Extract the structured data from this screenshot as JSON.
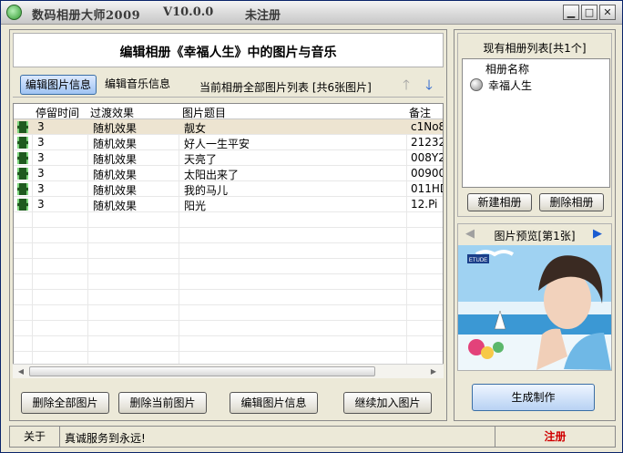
{
  "window": {
    "title": "数码相册大师2009",
    "version": "V10.0.0",
    "reg_state": "未注册",
    "min_glyph": "▁",
    "max_glyph": "□",
    "close_glyph": "✕"
  },
  "editor": {
    "heading": "编辑相册《幸福人生》中的图片与音乐",
    "tabs": [
      {
        "label": "编辑图片信息",
        "active": true
      },
      {
        "label": "编辑音乐信息",
        "active": false
      }
    ],
    "list_caption": "当前相册全部图片列表 [共6张图片]",
    "up_glyph": "🡑",
    "down_glyph": "🡓"
  },
  "table": {
    "columns": [
      "停留时间",
      "过渡效果",
      "图片题目",
      "备注"
    ],
    "rows": [
      {
        "duration": "3",
        "effect": "随机效果",
        "title": "靓女",
        "note": "c1No8",
        "selected": true
      },
      {
        "duration": "3",
        "effect": "随机效果",
        "title": "好人一生平安",
        "note": "21232",
        "selected": false
      },
      {
        "duration": "3",
        "effect": "随机效果",
        "title": "天亮了",
        "note": "008Y2",
        "selected": false
      },
      {
        "duration": "3",
        "effect": "随机效果",
        "title": "太阳出来了",
        "note": "00900",
        "selected": false
      },
      {
        "duration": "3",
        "effect": "随机效果",
        "title": "我的马儿",
        "note": "011HD",
        "selected": false
      },
      {
        "duration": "3",
        "effect": "随机效果",
        "title": "阳光",
        "note": "12.Pi",
        "selected": false
      }
    ]
  },
  "buttons": {
    "delete_all": "删除全部图片",
    "delete_current": "删除当前图片",
    "edit_info": "编辑图片信息",
    "add_more": "继续加入图片",
    "new_album": "新建相册",
    "delete_album": "删除相册",
    "generate": "生成制作"
  },
  "albums": {
    "title": "现有相册列表[共1个]",
    "column": "相册名称",
    "items": [
      "幸福人生"
    ]
  },
  "preview": {
    "title": "图片预览[第1张]",
    "prev_glyph": "◀",
    "next_glyph": "▶",
    "brand": "ETUDE"
  },
  "status": {
    "about": "关于",
    "message": "真诚服务到永远!",
    "register": "注册"
  },
  "colors": {
    "accent_blue": "#1a5bd0",
    "register_red": "#d00000",
    "selected_row": "#ede4d1"
  }
}
